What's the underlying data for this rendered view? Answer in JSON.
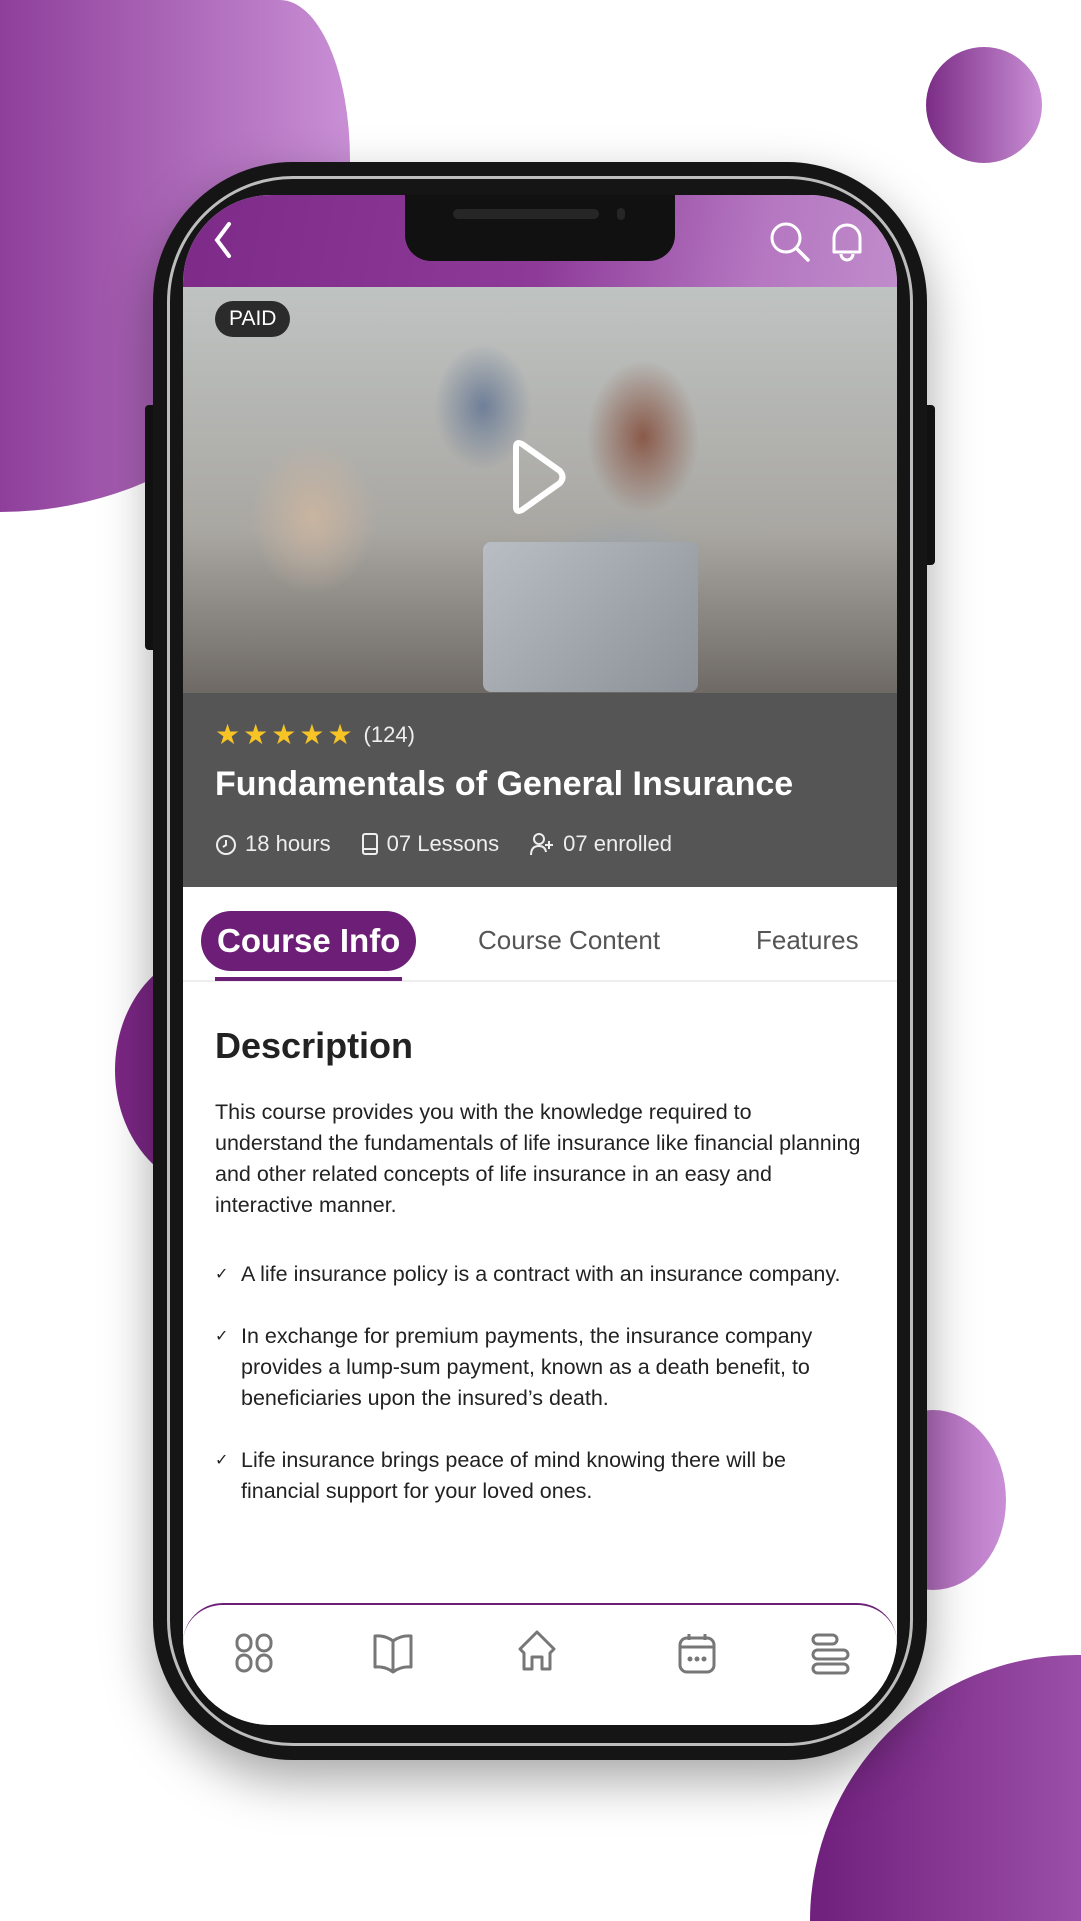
{
  "colors": {
    "brand": "#6d1f78",
    "header_gradient_end": "#c08ccb",
    "info_panel": "#555555",
    "star": "#f7c325"
  },
  "header": {
    "back_icon": "chevron-left-icon",
    "search_icon": "search-icon",
    "notification_icon": "bell-icon"
  },
  "hero": {
    "badge": "PAID",
    "play_icon": "play-icon"
  },
  "course": {
    "rating_stars": 5,
    "rating_count": "(124)",
    "title": "Fundamentals of General Insurance",
    "meta": [
      {
        "icon": "timer-icon",
        "label": "18 hours"
      },
      {
        "icon": "book-icon",
        "label": "07 Lessons"
      },
      {
        "icon": "user-add-icon",
        "label": "07 enrolled"
      }
    ]
  },
  "tabs": [
    {
      "label": "Course Info",
      "active": true
    },
    {
      "label": "Course Content"
    },
    {
      "label": "Features"
    }
  ],
  "description": {
    "heading": "Description",
    "paragraph": "This course provides you with the knowledge required to understand the fundamentals of life insurance like financial planning and other related concepts of life insurance in an easy and interactive manner.",
    "bullets": [
      "A life insurance policy is a contract with an insurance company.",
      "In exchange for premium payments, the insurance company provides a lump-sum payment, known as a death benefit, to beneficiaries upon the insured’s death.",
      "Life insurance brings peace of mind knowing there will be financial support for your loved ones."
    ]
  },
  "bottom_nav": [
    "grid-icon",
    "open-book-icon",
    "home-icon",
    "calendar-icon",
    "menu-icon"
  ]
}
